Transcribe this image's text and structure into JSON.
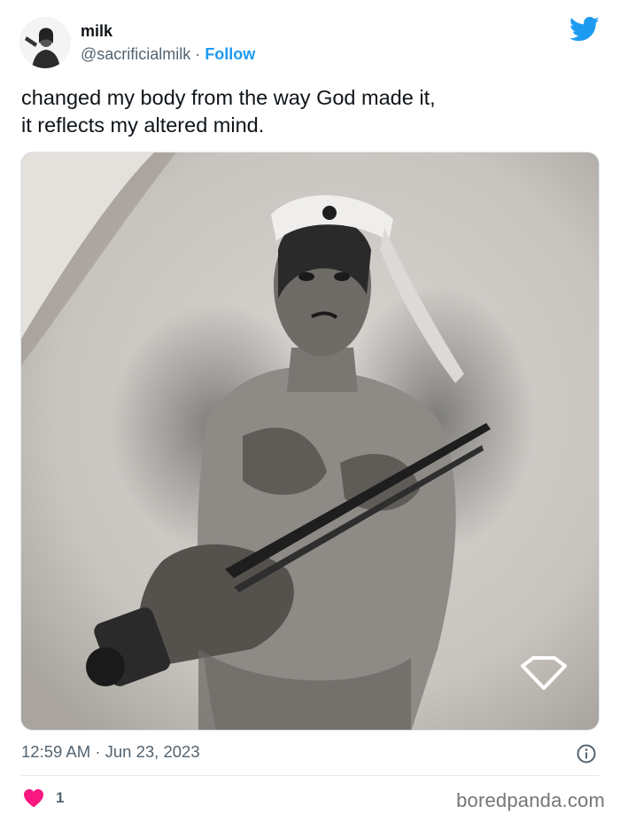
{
  "tweet": {
    "author_name": "milk",
    "handle": "@sacrificialmilk",
    "separator": "·",
    "follow_label": "Follow",
    "text_lines": [
      "changed my body from the way God made it,",
      "it reflects my altered mind."
    ],
    "media_icon": "tattoo-photo",
    "time": "12:59 AM",
    "date_separator": "·",
    "date": "Jun 23, 2023",
    "like_count": "1"
  },
  "icons": {
    "platform": "twitter-bird-icon",
    "info": "info-icon",
    "like": "heart-icon",
    "media_overlay": "diamond-icon"
  },
  "colors": {
    "twitter_blue": "#1d9bf0",
    "heart": "#f91880",
    "secondary_text": "#536471"
  },
  "watermark": "boredpanda.com"
}
